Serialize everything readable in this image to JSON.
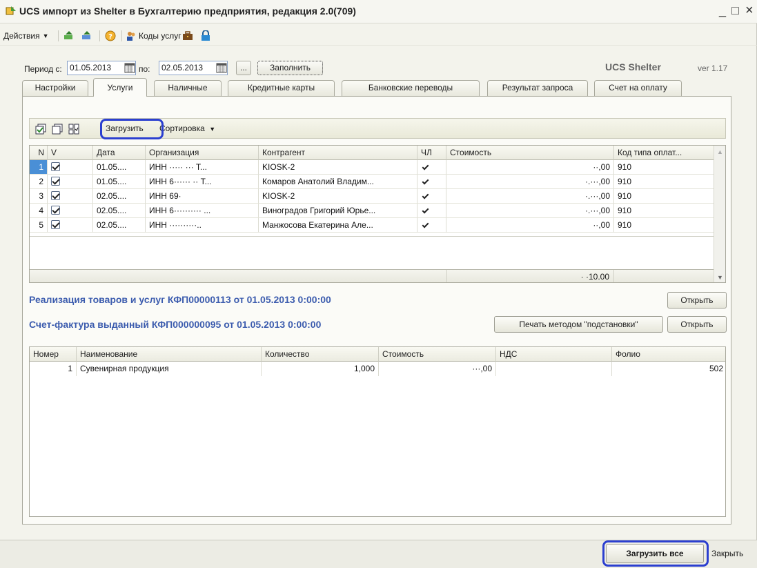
{
  "window": {
    "title": "UCS импорт из Shelter в Бухгалтерию предприятия, редакция 2.0(709)",
    "minimize": "_",
    "maximize": "□",
    "close": "×"
  },
  "toolbar": {
    "actions_label": "Действия",
    "codes_label": "Коды услуг"
  },
  "period": {
    "from_label": "Период с:",
    "from_value": "01.05.2013",
    "to_label": "по:",
    "to_value": "02.05.2013",
    "ellipsis_label": "...",
    "fill_label": "Заполнить",
    "brand": "UCS Shelter",
    "version": "ver 1.17"
  },
  "tabs": [
    {
      "label": "Настройки"
    },
    {
      "label": "Услуги"
    },
    {
      "label": "Наличные"
    },
    {
      "label": "Кредитные карты"
    },
    {
      "label": "Банковские переводы"
    },
    {
      "label": "Результат запроса"
    },
    {
      "label": "Счет на оплату"
    }
  ],
  "grid_toolbar": {
    "load_label": "Загрузить",
    "sort_label": "Сортировка"
  },
  "services_table": {
    "columns": [
      "N",
      "V",
      "Дата",
      "Организация",
      "Контрагент",
      "ЧЛ",
      "Стоимость",
      "Код типа оплат..."
    ],
    "rows": [
      {
        "n": "1",
        "date": "01.05....",
        "org": "ИНН ····· ··· Т...",
        "contractor": "KIOSK-2",
        "cost": "··,00",
        "code": "910"
      },
      {
        "n": "2",
        "date": "01.05....",
        "org": "ИНН 6······ ·· Т...",
        "contractor": "Комаров Анатолий Владим...",
        "cost": "·.···,00",
        "code": "910"
      },
      {
        "n": "3",
        "date": "02.05....",
        "org": "ИНН 69·",
        "contractor": "KIOSK-2",
        "cost": "·.···,00",
        "code": "910"
      },
      {
        "n": "4",
        "date": "02.05....",
        "org": "ИНН 6·········· ...",
        "contractor": "Виноградов Григорий Юрье...",
        "cost": "·.···,00",
        "code": "910"
      },
      {
        "n": "5",
        "date": "02.05....",
        "org": "ИНН ··········..",
        "contractor": "Манжосова Екатерина Але...",
        "cost": "··,00",
        "code": "910"
      }
    ],
    "total": "· ·10.00"
  },
  "documents": {
    "realization": "Реализация товаров и услуг КФП00000113 от 01.05.2013 0:00:00",
    "invoice": "Счет-фактура выданный КФП000000095 от 01.05.2013 0:00:00",
    "open_label": "Открыть",
    "print_label": "Печать методом \"подстановки\""
  },
  "items_table": {
    "columns": [
      "Номер",
      "Наименование",
      "Количество",
      "Стоимость",
      "НДС",
      "Фолио"
    ],
    "rows": [
      {
        "num": "1",
        "name": "Сувенирная продукция",
        "qty": "1,000",
        "cost": "···,00",
        "vat": "",
        "folio": "502"
      }
    ]
  },
  "bottom": {
    "load_all_label": "Загрузить все",
    "close_label": "Закрыть"
  },
  "colors": {
    "highlight": "#2b3fd0",
    "link": "#3c5cae",
    "selected_row": "#4a8fd6"
  }
}
